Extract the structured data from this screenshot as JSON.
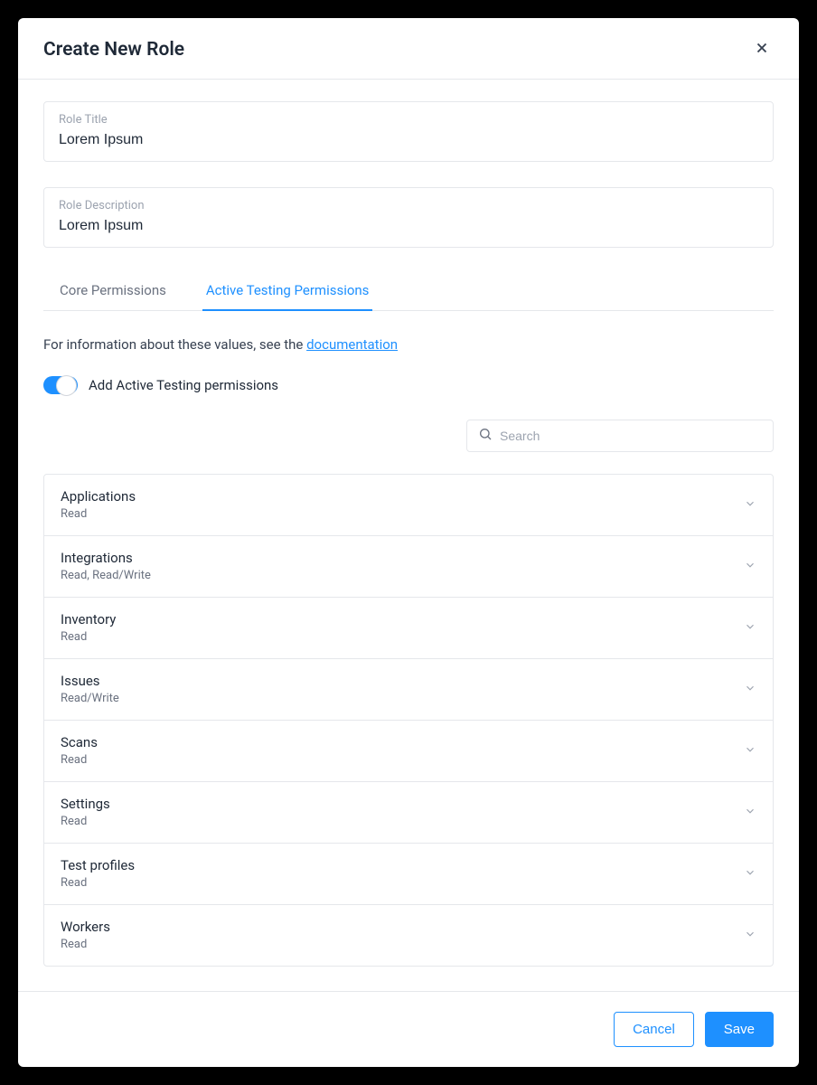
{
  "modal": {
    "title": "Create New Role",
    "roleTitleLabel": "Role Title",
    "roleTitleValue": "Lorem Ipsum",
    "roleDescLabel": "Role Description",
    "roleDescValue": "Lorem Ipsum"
  },
  "tabs": {
    "core": "Core Permissions",
    "active": "Active Testing Permissions"
  },
  "infoPrefix": "For information about these values, see the ",
  "infoLink": "documentation",
  "toggleLabel": "Add Active Testing permissions",
  "searchPlaceholder": "Search",
  "permissions": [
    {
      "title": "Applications",
      "sub": "Read"
    },
    {
      "title": "Integrations",
      "sub": "Read, Read/Write"
    },
    {
      "title": "Inventory",
      "sub": "Read"
    },
    {
      "title": "Issues",
      "sub": "Read/Write"
    },
    {
      "title": "Scans",
      "sub": "Read"
    },
    {
      "title": "Settings",
      "sub": "Read"
    },
    {
      "title": "Test profiles",
      "sub": "Read"
    },
    {
      "title": "Workers",
      "sub": "Read"
    }
  ],
  "buttons": {
    "cancel": "Cancel",
    "save": "Save"
  }
}
